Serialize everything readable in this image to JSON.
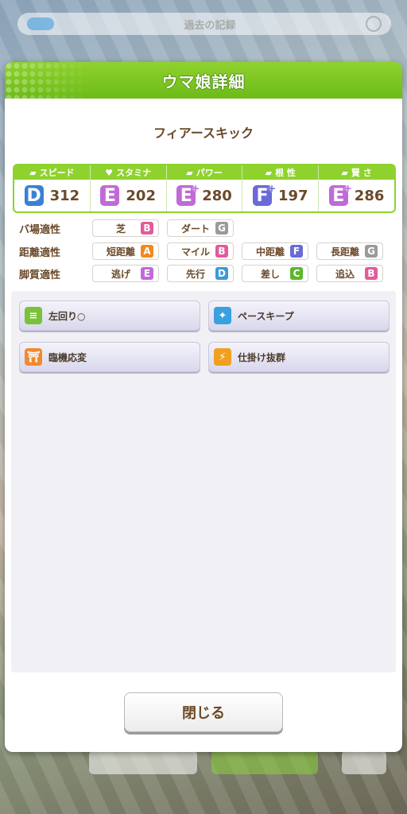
{
  "background": {
    "top_bar_text": "過去の記録"
  },
  "dialog": {
    "title": "ウマ娘詳細",
    "uma_name": "フィアースキック",
    "stats": [
      {
        "label": "スピード",
        "icon": "shoe-icon",
        "grade": "D",
        "plus": "",
        "value": "312",
        "color": "#3a7fd8"
      },
      {
        "label": "スタミナ",
        "icon": "heart-icon",
        "grade": "E",
        "plus": "",
        "value": "202",
        "color": "#c06ad8"
      },
      {
        "label": "パワー",
        "icon": "muscle-icon",
        "grade": "E",
        "plus": "+",
        "value": "280",
        "color": "#c06ad8"
      },
      {
        "label": "根 性",
        "icon": "flame-icon",
        "grade": "F",
        "plus": "+",
        "value": "197",
        "color": "#6a6ad8"
      },
      {
        "label": "賢 さ",
        "icon": "graduation-cap-icon",
        "grade": "E",
        "plus": "+",
        "value": "286",
        "color": "#c06ad8"
      }
    ],
    "aptitudes": [
      {
        "label": "バ場適性",
        "items": [
          {
            "name": "芝",
            "grade": "B",
            "color": "#e25b9a"
          },
          {
            "name": "ダート",
            "grade": "G",
            "color": "#9a9a9a"
          }
        ]
      },
      {
        "label": "距離適性",
        "items": [
          {
            "name": "短距離",
            "grade": "A",
            "color": "#f08a1c"
          },
          {
            "name": "マイル",
            "grade": "B",
            "color": "#e25b9a"
          },
          {
            "name": "中距離",
            "grade": "F",
            "color": "#6a6ad8"
          },
          {
            "name": "長距離",
            "grade": "G",
            "color": "#9a9a9a"
          }
        ]
      },
      {
        "label": "脚質適性",
        "items": [
          {
            "name": "逃げ",
            "grade": "E",
            "color": "#c06ad8"
          },
          {
            "name": "先行",
            "grade": "D",
            "color": "#3a9ad8"
          },
          {
            "name": "差し",
            "grade": "C",
            "color": "#5ab82a"
          },
          {
            "name": "追込",
            "grade": "B",
            "color": "#e25b9a"
          }
        ]
      }
    ],
    "skills": [
      {
        "name": "左回り○",
        "icon": "left-turn-icon",
        "color": "#7ac23a"
      },
      {
        "name": "ペースキープ",
        "icon": "sparkle-icon",
        "color": "#3aa0e0"
      },
      {
        "name": "臨機応変",
        "icon": "gate-icon",
        "color": "#f08a30"
      },
      {
        "name": "仕掛け抜群",
        "icon": "runner-icon",
        "color": "#f0a020"
      }
    ],
    "close_label": "閉じる"
  }
}
